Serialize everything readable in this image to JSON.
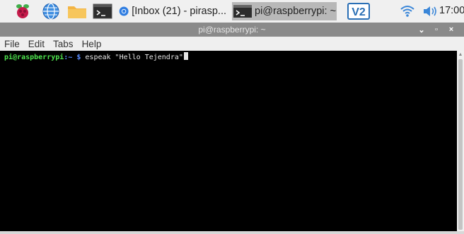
{
  "taskbar": {
    "icons": {
      "raspberry": "raspberry-pi-menu-icon",
      "browser": "globe-icon",
      "file_manager": "folder-icon",
      "terminal": "terminal-icon"
    },
    "tasks": [
      {
        "label": "[Inbox (21) - pirasp...",
        "icon": "chromium-icon"
      },
      {
        "label": "pi@raspberrypi: ~",
        "icon": "terminal-icon",
        "active": true
      }
    ],
    "tray": {
      "vnc_label": "V2",
      "wifi_icon": "wifi-icon",
      "volume_icon": "volume-icon",
      "clock": "17:00"
    }
  },
  "window": {
    "title": "pi@raspberrypi: ~",
    "controls": {
      "minimize": "⌄",
      "maximize": "▫",
      "close": "×"
    }
  },
  "menu": {
    "items": [
      "File",
      "Edit",
      "Tabs",
      "Help"
    ]
  },
  "terminal": {
    "prompt_user": "pi@raspberrypi",
    "prompt_path": ":~ $",
    "command": " espeak \"Hello Tejendra\""
  },
  "colors": {
    "taskbar_bg": "#f0f0f0",
    "titlebar_bg": "#8a8a8a",
    "terminal_bg": "#000000",
    "prompt_user": "#4ee44e",
    "prompt_path": "#5a8cff"
  }
}
